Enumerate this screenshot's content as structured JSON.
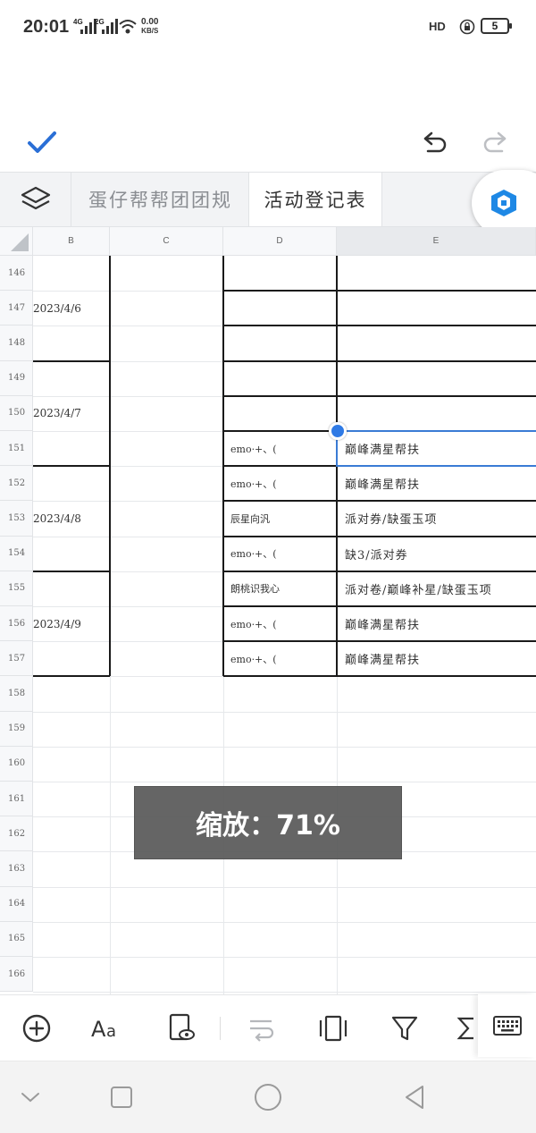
{
  "status_bar": {
    "time": "20:01",
    "signal_1": "4G",
    "signal_2": "2G",
    "net_speed": "0.00",
    "net_unit": "KB/S",
    "hd": "HD",
    "battery": "5"
  },
  "tabs": [
    {
      "label": "蛋仔帮帮团团规",
      "active": false
    },
    {
      "label": "活动登记表",
      "active": true
    }
  ],
  "columns": [
    "B",
    "C",
    "D",
    "E"
  ],
  "selected_column": "E",
  "rows": [
    "146",
    "147",
    "148",
    "149",
    "150",
    "151",
    "152",
    "153",
    "154",
    "155",
    "156",
    "157",
    "158",
    "159",
    "160",
    "161",
    "162",
    "163",
    "164",
    "165",
    "166"
  ],
  "dates": [
    "2023/4/6",
    "2023/4/7",
    "2023/4/8",
    "2023/4/9"
  ],
  "entries": [
    {
      "row": "151",
      "d": "emo·+、(",
      "e": "巅峰满星帮扶"
    },
    {
      "row": "152",
      "d": "emo·+、(",
      "e": "巅峰满星帮扶"
    },
    {
      "row": "153",
      "d": "辰星向汎",
      "e": "派对券/缺蛋玉项"
    },
    {
      "row": "154",
      "d": "emo·+、(",
      "e": "缺3/派对券"
    },
    {
      "row": "155",
      "d": "朗桃识我心",
      "e": "派对卷/巅峰补星/缺蛋玉项"
    },
    {
      "row": "156",
      "d": "emo·+、(",
      "e": "巅峰满星帮扶"
    },
    {
      "row": "157",
      "d": "emo·+、(",
      "e": "巅峰满星帮扶"
    }
  ],
  "selected_cell": "E151",
  "zoom_toast": "缩放：71%",
  "colors": {
    "accent": "#2f7ae5",
    "check": "#2a6fd6"
  },
  "icons": {
    "confirm": "check-icon",
    "undo": "undo-icon",
    "redo": "redo-icon",
    "sheets": "layers-icon",
    "insert": "plus-circle-icon",
    "font": "font-format-icon",
    "preview": "page-preview-icon",
    "wrap": "wrap-text-icon",
    "freeze": "freeze-columns-icon",
    "filter": "filter-icon",
    "sum": "sigma-icon",
    "keyboard": "keyboard-icon"
  }
}
